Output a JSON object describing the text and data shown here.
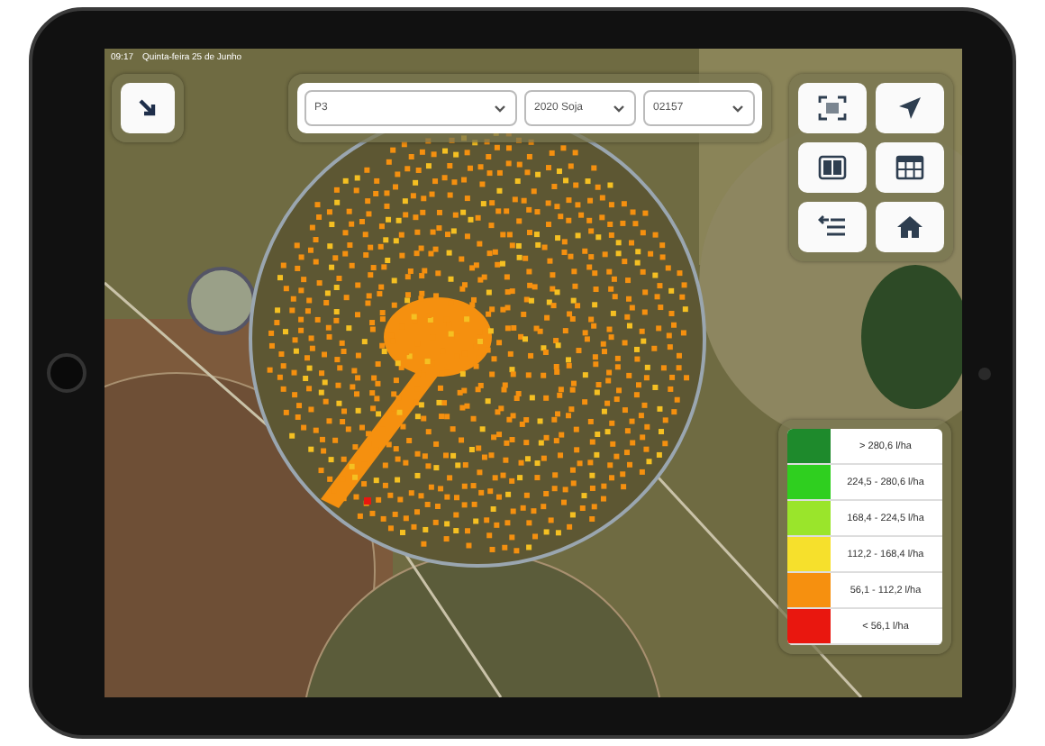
{
  "status_bar": {
    "time": "09:17",
    "date": "Quinta-feira 25 de Junho"
  },
  "filters": [
    {
      "value": "P3"
    },
    {
      "value": "2020 Soja"
    },
    {
      "value": "02157"
    }
  ],
  "legend": [
    {
      "label": "> 280,6 l/ha",
      "color": "#1e8a2c"
    },
    {
      "label": "224,5 - 280,6 l/ha",
      "color": "#2fcf1f"
    },
    {
      "label": "168,4 - 224,5 l/ha",
      "color": "#9ae52b"
    },
    {
      "label": "112,2 - 168,4 l/ha",
      "color": "#f6e02c"
    },
    {
      "label": "56,1 - 112,2 l/ha",
      "color": "#f6900f"
    },
    {
      "label": "< 56,1 l/ha",
      "color": "#e9170f"
    }
  ]
}
